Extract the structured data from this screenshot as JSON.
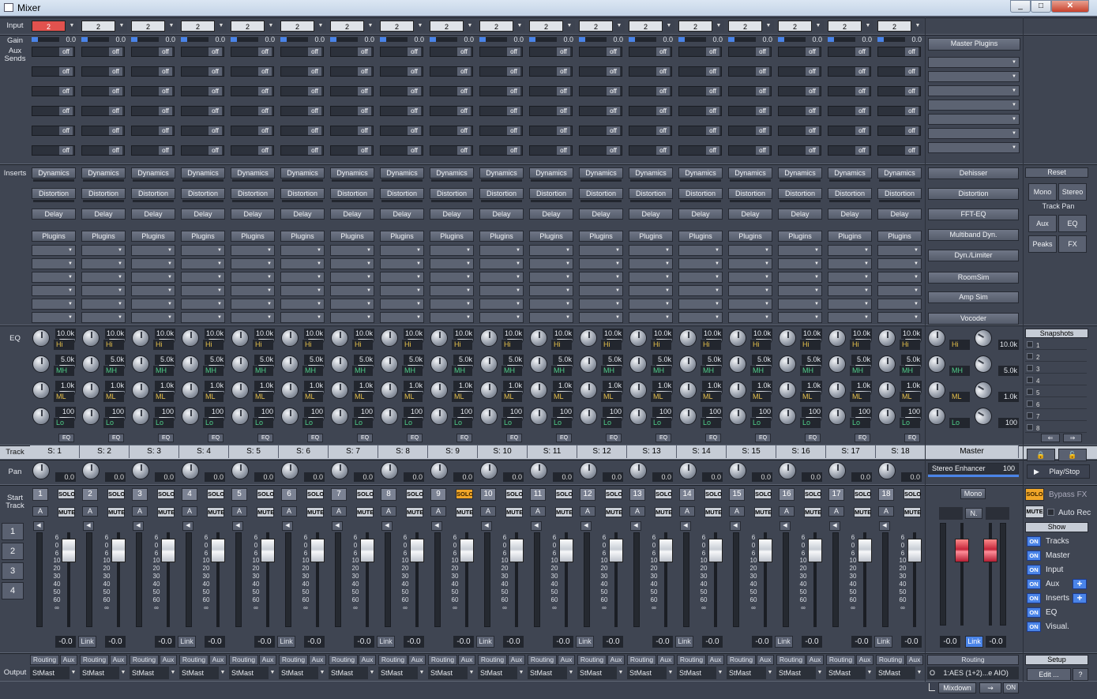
{
  "window": {
    "title": "Mixer",
    "controls": [
      "_",
      "□",
      "✕"
    ]
  },
  "row_labels": {
    "input": "Input",
    "gain": "Gain",
    "aux_sends": "Aux Sends",
    "inserts": "Inserts",
    "eq": "EQ",
    "track": "Track",
    "pan": "Pan",
    "start_track": "Start Track",
    "output": "Output"
  },
  "start_track_buttons": [
    "1",
    "2",
    "3",
    "4"
  ],
  "channel_defaults": {
    "input_value": "2",
    "gain_value": "0.0",
    "send_label": "off",
    "insert_labels": [
      "Dynamics",
      "Distortion",
      "Delay",
      "Plugins"
    ],
    "eq": [
      {
        "freq": "10.0k",
        "band": "Hi"
      },
      {
        "freq": "5.0k",
        "band": "MH"
      },
      {
        "freq": "1.0k",
        "band": "ML"
      },
      {
        "freq": "100",
        "band": "Lo"
      }
    ],
    "eq_button": "EQ",
    "pan_value": "0.0",
    "solo": "SOLO",
    "mute": "MUTE",
    "auto": "A",
    "fader_db": "-0.0",
    "link": "Link",
    "routing": "Routing",
    "aux": "Aux",
    "output": "StMast",
    "meter_scale": [
      "6",
      "0",
      "6",
      "10",
      "20",
      "30",
      "40",
      "50",
      "60",
      "∞"
    ]
  },
  "channels": [
    "S: 1",
    "S: 2",
    "S: 3",
    "S: 4",
    "S: 5",
    "S: 6",
    "S: 7",
    "S: 8",
    "S: 9",
    "S: 10",
    "S: 11",
    "S: 12",
    "S: 13",
    "S: 14",
    "S: 15",
    "S: 16",
    "S: 17",
    "S: 18"
  ],
  "channel_numbers": [
    "1",
    "2",
    "3",
    "4",
    "5",
    "6",
    "7",
    "8",
    "9",
    "10",
    "11",
    "12",
    "13",
    "14",
    "15",
    "16",
    "17",
    "18"
  ],
  "solo_active_channel": 9,
  "master": {
    "plugins_label": "Master Plugins",
    "inserts": [
      "Dehisser",
      "Distortion",
      "FFT-EQ",
      "Multiband Dyn.",
      "Dyn./Limiter",
      "RoomSim",
      "Amp Sim",
      "Vocoder"
    ],
    "eq": [
      {
        "freq": "10.0k",
        "band": "Hi"
      },
      {
        "freq": "5.0k",
        "band": "MH"
      },
      {
        "freq": "1.0k",
        "band": "ML"
      },
      {
        "freq": "100",
        "band": "Lo"
      }
    ],
    "track_label": "Master",
    "stereo_enhancer": "Stereo Enhancer",
    "stereo_enhancer_value": "100",
    "mono": "Mono",
    "n_label": "N.",
    "db_left": "-0.0",
    "db_right": "-0.0",
    "link": "Link",
    "routing": "Routing",
    "output": "1:AES (1+2)...e AIO)",
    "output_prefix": "O",
    "mixdown": "Mixdown",
    "on": "ON"
  },
  "right_panel": {
    "reset": "Reset",
    "mono": "Mono",
    "stereo": "Stereo",
    "track_pan": "Track Pan",
    "aux": "Aux",
    "eq": "EQ",
    "peaks": "Peaks",
    "fx": "FX",
    "snapshots": "Snapshots",
    "snapshot_items": [
      "1",
      "2",
      "3",
      "4",
      "5",
      "6",
      "7",
      "8"
    ],
    "play_stop": "Play/Stop",
    "solo": "SOLO",
    "bypass_fx": "Bypass FX",
    "mute": "MUTE",
    "auto_rec": "Auto Rec",
    "show": "Show",
    "show_items": [
      {
        "on": "ON",
        "label": "Tracks"
      },
      {
        "on": "ON",
        "label": "Master"
      },
      {
        "on": "ON",
        "label": "Input"
      },
      {
        "on": "ON",
        "label": "Aux"
      },
      {
        "on": "ON",
        "label": "Inserts"
      },
      {
        "on": "ON",
        "label": "EQ"
      },
      {
        "on": "ON",
        "label": "Visual."
      }
    ],
    "setup": "Setup",
    "edit": "Edit ...",
    "help": "?"
  },
  "colors": {
    "accent_blue": "#4a84e8",
    "solo_active": "#f0a628",
    "input_active": "#e2524e",
    "band_hi": "#e7c14a",
    "band_mh": "#4fd08a",
    "band_ml": "#e7c14a",
    "band_lo": "#4fd08a"
  }
}
